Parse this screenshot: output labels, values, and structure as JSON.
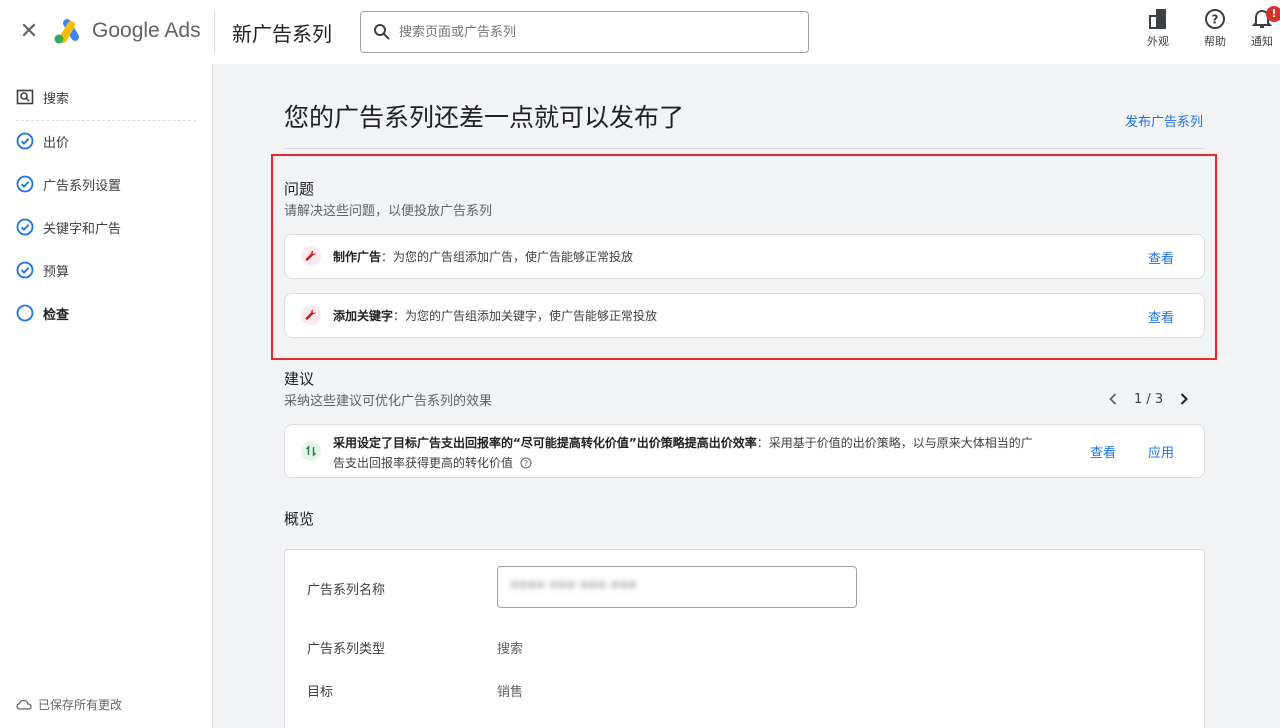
{
  "header": {
    "brand": "Google Ads",
    "page_name": "新广告系列",
    "search_placeholder": "搜索页面或广告系列",
    "tools": [
      {
        "label": "外观",
        "icon": "appearance-icon"
      },
      {
        "label": "帮助",
        "icon": "help-icon"
      },
      {
        "label": "通知",
        "icon": "bell-icon",
        "badge": "!"
      }
    ]
  },
  "sidebar": {
    "items": [
      {
        "label": "搜索",
        "icon": "search-box-icon",
        "status": "none"
      },
      {
        "label": "出价",
        "icon": "check-circle-icon",
        "status": "done"
      },
      {
        "label": "广告系列设置",
        "icon": "check-circle-icon",
        "status": "done"
      },
      {
        "label": "关键字和广告",
        "icon": "check-circle-icon",
        "status": "done"
      },
      {
        "label": "预算",
        "icon": "check-circle-icon",
        "status": "done"
      },
      {
        "label": "检查",
        "icon": "circle-icon",
        "status": "current"
      }
    ],
    "saved_status": "已保存所有更改"
  },
  "main": {
    "title": "您的广告系列还差一点就可以发布了",
    "publish_link": "发布广告系列",
    "issues": {
      "title": "问题",
      "subtitle": "请解决这些问题，以便投放广告系列",
      "items": [
        {
          "label": "制作广告",
          "text": "：为您的广告组添加广告，使广告能够正常投放",
          "action": "查看"
        },
        {
          "label": "添加关键字",
          "text": "：为您的广告组添加关键字，使广告能够正常投放",
          "action": "查看"
        }
      ]
    },
    "recommendations": {
      "title": "建议",
      "subtitle": "采纳这些建议可优化广告系列的效果",
      "pager": "1 / 3",
      "item": {
        "label": "采用设定了目标广告支出回报率的“尽可能提高转化价值”出价策略提高出价效率",
        "text_line1": "：采用基于价值的出价策略，以与原来大体相当的广",
        "text_line2": "告支出回报率获得更高的转化价值",
        "view": "查看",
        "apply": "应用"
      }
    },
    "overview": {
      "title": "概览",
      "name_label": "广告系列名称",
      "type_label": "广告系列类型",
      "type_value": "搜索",
      "goal_label": "目标",
      "goal_value": "销售"
    }
  },
  "colors": {
    "accent": "#1a73e8",
    "highlight_box": "#e8262b",
    "issue_icon_bg": "#fce8ef",
    "issue_icon": "#c5221f",
    "rec_icon_bg": "#e6f4ea",
    "rec_icon": "#188038"
  }
}
